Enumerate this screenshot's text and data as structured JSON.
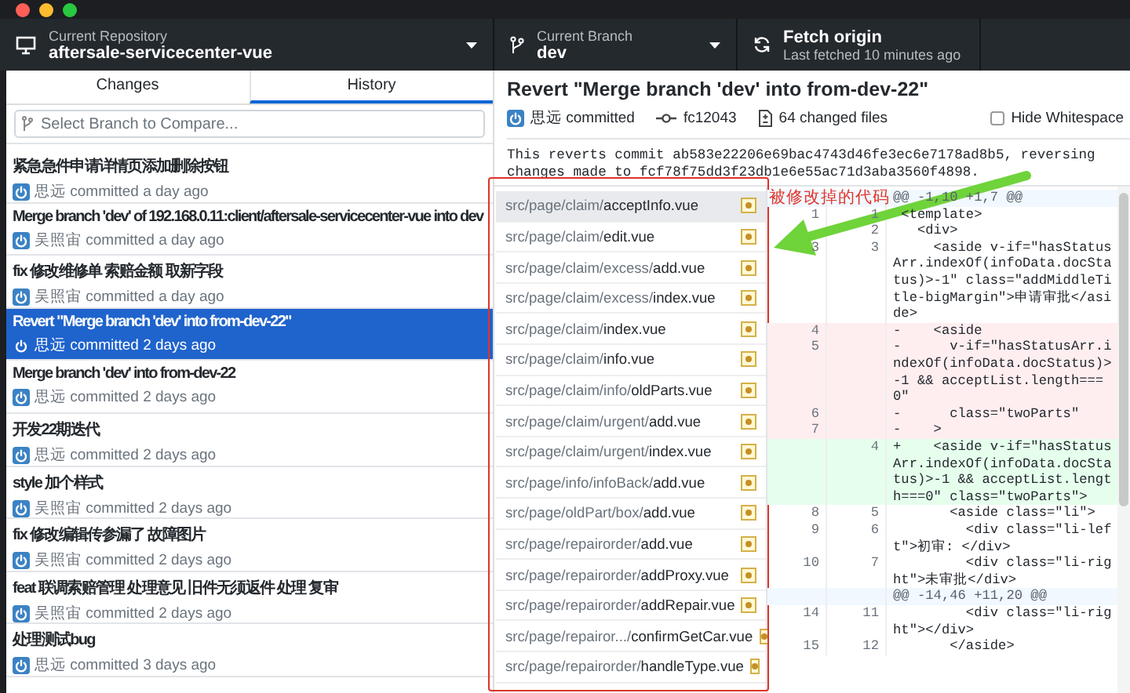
{
  "toolbar": {
    "repository": {
      "label": "Current Repository",
      "value": "aftersale-servicecenter-vue"
    },
    "branch": {
      "label": "Current Branch",
      "value": "dev"
    },
    "fetch": {
      "label": "Fetch origin",
      "value": "Last fetched 10 minutes ago"
    }
  },
  "tabs": [
    {
      "label": "Changes",
      "selected": false
    },
    {
      "label": "History",
      "selected": true
    }
  ],
  "branch_search": {
    "placeholder": "Select Branch to Compare..."
  },
  "commits": [
    {
      "title": "紧急急件申请详情页添加删除按钮",
      "meta": "思远 committed a day ago",
      "selected": false
    },
    {
      "title": "Merge branch 'dev' of 192.168.0.11:client/aftersale-servicecenter-vue into dev",
      "meta": "吴照宙 committed a day ago",
      "selected": false
    },
    {
      "title": "fix 修改维修单 索赔金额 取新字段",
      "meta": "吴照宙 committed a day ago",
      "selected": false
    },
    {
      "title": "Revert \"Merge branch 'dev' into from-dev-22\"",
      "meta": "思远 committed 2 days ago",
      "selected": true
    },
    {
      "title": "Merge branch 'dev' into from-dev-22",
      "meta": "思远 committed 2 days ago",
      "selected": false
    },
    {
      "title": "开发22期迭代",
      "meta": "思远 committed 2 days ago",
      "selected": false
    },
    {
      "title": "style 加个样式",
      "meta": "吴照宙 committed 2 days ago",
      "selected": false
    },
    {
      "title": "fix 修改编辑传参漏了 故障图片",
      "meta": "吴照宙 committed 2 days ago",
      "selected": false
    },
    {
      "title": "feat 联调索赔管理 处理意见 旧件无须返件 处理 复审",
      "meta": "吴照宙 committed 2 days ago",
      "selected": false
    },
    {
      "title": "处理测试bug",
      "meta": "思远 committed 3 days ago",
      "selected": false
    }
  ],
  "commit_detail": {
    "title": "Revert \"Merge branch 'dev' into from-dev-22\"",
    "author": "思远 committed",
    "sha": "fc12043",
    "changed_files": "64 changed files",
    "hide_whitespace": {
      "label": "Hide Whitespace",
      "checked": false
    },
    "description": "This reverts commit ab583e22206e69bac4743d46fe3ec6e7178ad8b5, reversing\nchanges made to fcf78f75dd3f23db1e6e55ac71d3aba3560f4898."
  },
  "files": [
    {
      "dir": "src/page/claim/",
      "name": "acceptInfo.vue",
      "selected": true
    },
    {
      "dir": "src/page/claim/",
      "name": "edit.vue",
      "selected": false
    },
    {
      "dir": "src/page/claim/excess/",
      "name": "add.vue",
      "selected": false
    },
    {
      "dir": "src/page/claim/excess/",
      "name": "index.vue",
      "selected": false
    },
    {
      "dir": "src/page/claim/",
      "name": "index.vue",
      "selected": false
    },
    {
      "dir": "src/page/claim/",
      "name": "info.vue",
      "selected": false
    },
    {
      "dir": "src/page/claim/info/",
      "name": "oldParts.vue",
      "selected": false
    },
    {
      "dir": "src/page/claim/urgent/",
      "name": "add.vue",
      "selected": false
    },
    {
      "dir": "src/page/claim/urgent/",
      "name": "index.vue",
      "selected": false
    },
    {
      "dir": "src/page/info/infoBack/",
      "name": "add.vue",
      "selected": false
    },
    {
      "dir": "src/page/oldPart/box/",
      "name": "add.vue",
      "selected": false
    },
    {
      "dir": "src/page/repairorder/",
      "name": "add.vue",
      "selected": false
    },
    {
      "dir": "src/page/repairorder/",
      "name": "addProxy.vue",
      "selected": false
    },
    {
      "dir": "src/page/repairorder/",
      "name": "addRepair.vue",
      "selected": false
    },
    {
      "dir": "src/page/repairor.../",
      "name": "confirmGetCar.vue",
      "selected": false
    },
    {
      "dir": "src/page/repairorder/",
      "name": "handleType.vue",
      "selected": false
    }
  ],
  "diff": [
    {
      "kind": "hunk",
      "text": "@@ -1,10 +1,7 @@"
    },
    {
      "kind": "context",
      "old": "1",
      "new": "1",
      "text": " <template>"
    },
    {
      "kind": "context",
      "new": "2",
      "text": "   <div>"
    },
    {
      "kind": "context",
      "old": "3",
      "new": "3",
      "text": "     <aside v-if=\"hasStatusArr.indexOf(infoData.docStatus)>-1\" class=\"addMiddleTitle-bigMargin\">申请审批</aside>"
    },
    {
      "kind": "del",
      "old": "4",
      "text": "-    <aside"
    },
    {
      "kind": "del",
      "old": "5",
      "text": "-      v-if=\"hasStatusArr.indexOf(infoData.docStatus)>-1 && acceptList.length===0\""
    },
    {
      "kind": "del",
      "old": "6",
      "text": "-      class=\"twoParts\""
    },
    {
      "kind": "del",
      "old": "7",
      "text": "-    >"
    },
    {
      "kind": "add",
      "new": "4",
      "text": "+    <aside v-if=\"hasStatusArr.indexOf(infoData.docStatus)>-1 && acceptList.length===0\" class=\"twoParts\">"
    },
    {
      "kind": "context",
      "old": "8",
      "new": "5",
      "text": "       <aside class=\"li\">"
    },
    {
      "kind": "context",
      "old": "9",
      "new": "6",
      "text": "         <div class=\"li-left\">初审: </div>"
    },
    {
      "kind": "context",
      "old": "10",
      "new": "7",
      "text": "         <div class=\"li-right\">未审批</div>"
    },
    {
      "kind": "hunk",
      "text": "@@ -14,46 +11,20 @@"
    },
    {
      "kind": "context",
      "old": "14",
      "new": "11",
      "text": "         <div class=\"li-right\"></div>"
    },
    {
      "kind": "context",
      "old": "15",
      "new": "12",
      "text": "       </aside>"
    }
  ],
  "annotation": {
    "text": "被修改掉的代码"
  }
}
